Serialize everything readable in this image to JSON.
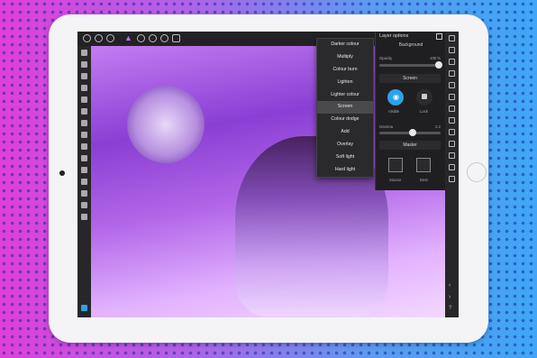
{
  "layer_panel": {
    "title": "Layer options",
    "layer_name": "Background",
    "opacity_label": "Opacity",
    "opacity_value": "100 %",
    "opacity_level": 1.0,
    "blend_mode": "Screen",
    "visible_label": "Visible",
    "lock_label": "Lock",
    "gamma_label": "Gamma",
    "gamma_value": "2.2",
    "master_label": "Master",
    "source_label": "Source",
    "dest_label": "Dest"
  },
  "blend_modes": {
    "items": [
      "Darker colour",
      "Multiply",
      "Colour burn",
      "Lighten",
      "Lighter colour",
      "Screen",
      "Colour dodge",
      "Add",
      "Overlay",
      "Soft light",
      "Hard light"
    ],
    "selected": "Screen"
  },
  "colors": {
    "accent": "#2aa3e8",
    "toolbar": "#222224"
  }
}
